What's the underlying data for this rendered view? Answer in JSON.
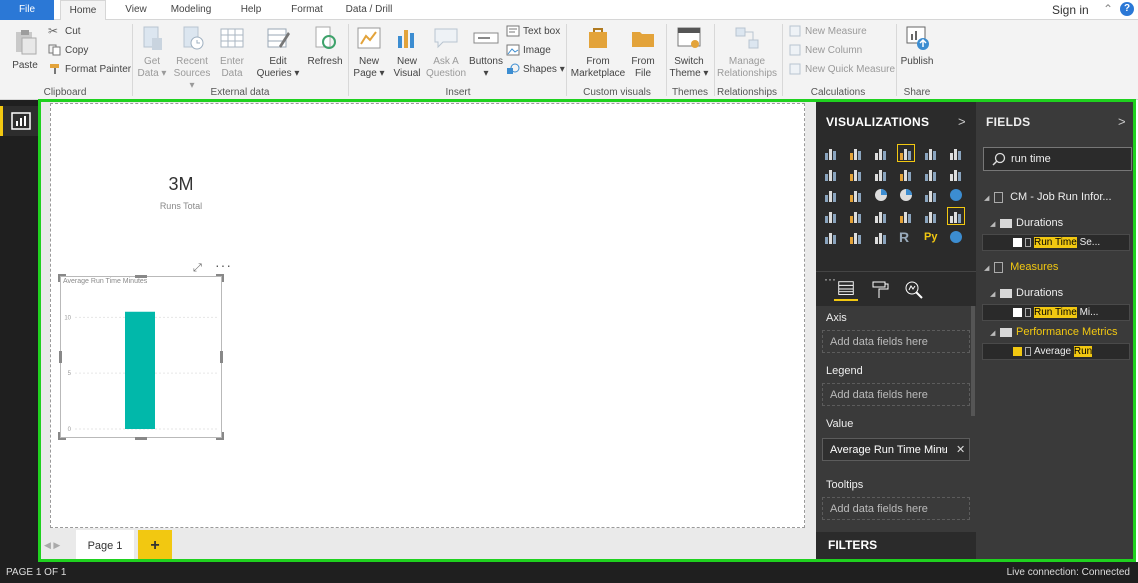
{
  "ribbon": {
    "tabs": [
      "File",
      "Home",
      "View",
      "Modeling",
      "Help",
      "Format",
      "Data / Drill"
    ],
    "active_tab": "Home",
    "signin": "Sign in",
    "help": "?",
    "clipboard": {
      "paste": "Paste",
      "cut": "Cut",
      "copy": "Copy",
      "format_painter": "Format Painter",
      "label": "Clipboard"
    },
    "external": {
      "get_data": "Get",
      "get_data2": "Data",
      "recent": "Recent",
      "recent2": "Sources",
      "enter": "Enter",
      "enter2": "Data",
      "edit": "Edit",
      "edit2": "Queries",
      "refresh": "Refresh",
      "label": "External data"
    },
    "insert": {
      "new_page": "New",
      "new_page2": "Page",
      "new_visual": "New",
      "new_visual2": "Visual",
      "ask": "Ask A",
      "ask2": "Question",
      "buttons": "Buttons",
      "textbox": "Text box",
      "image": "Image",
      "shapes": "Shapes",
      "label": "Insert"
    },
    "custom": {
      "marketplace": "From",
      "marketplace2": "Marketplace",
      "file": "From",
      "file2": "File",
      "label": "Custom visuals"
    },
    "themes": {
      "switch": "Switch",
      "switch2": "Theme",
      "label": "Themes"
    },
    "relationships": {
      "manage": "Manage",
      "manage2": "Relationships",
      "label": "Relationships"
    },
    "calculations": {
      "new_measure": "New Measure",
      "new_column": "New Column",
      "new_quick": "New Quick Measure",
      "label": "Calculations"
    },
    "share": {
      "publish": "Publish",
      "label": "Share"
    }
  },
  "canvas": {
    "card": {
      "value": "3M",
      "label": "Runs Total"
    },
    "visual": {
      "title": "Average Run Time Minutes"
    },
    "more": "···"
  },
  "chart_data": {
    "type": "bar",
    "categories": [
      ""
    ],
    "values": [
      10.5
    ],
    "ylim": [
      0,
      12
    ],
    "yticks": [
      "10",
      "5",
      "0"
    ],
    "bar_color": "#01b8aa"
  },
  "pages": {
    "tab": "Page 1",
    "add": "+"
  },
  "viz": {
    "header": "VISUALIZATIONS",
    "chevron": ">",
    "more": "···",
    "wells": {
      "axis": "Axis",
      "axis_placeholder": "Add data fields here",
      "legend": "Legend",
      "legend_placeholder": "Add data fields here",
      "value": "Value",
      "value_field": "Average Run Time Minu",
      "tooltips": "Tooltips",
      "tooltips_placeholder": "Add data fields here"
    },
    "filters": "FILTERS"
  },
  "fields": {
    "header": "FIELDS",
    "chevron": ">",
    "search_value": "run time",
    "table1": "CM - Job Run Infor...",
    "folder1": "Durations",
    "f1_hl": "Run Time",
    "f1_rest": " Se...",
    "table2": "Measures",
    "folder2": "Durations",
    "f2_hl": "Run Time",
    "f2_rest": " Mi...",
    "folder3": "Performance Metrics",
    "f3_pre": "Average ",
    "f3_hl": "Run"
  },
  "status": {
    "left": "PAGE 1 OF 1",
    "right": "Live connection: Connected"
  }
}
